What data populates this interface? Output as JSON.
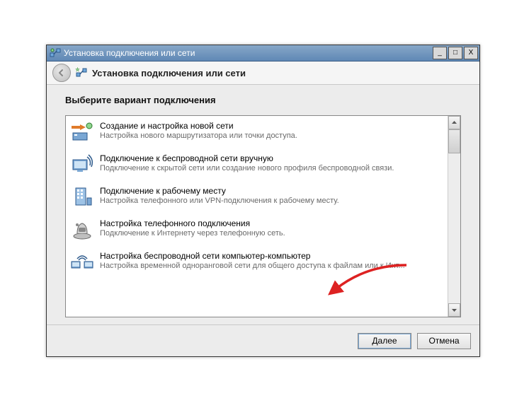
{
  "window": {
    "title": "Установка подключения или сети"
  },
  "header": {
    "title": "Установка подключения или сети"
  },
  "page": {
    "heading": "Выберите вариант подключения"
  },
  "options": [
    {
      "title": "Создание и настройка новой сети",
      "desc": "Настройка нового маршрутизатора или точки доступа.",
      "icon": "router-new-icon"
    },
    {
      "title": "Подключение к беспроводной сети вручную",
      "desc": "Подключение к скрытой сети или создание нового профиля беспроводной связи.",
      "icon": "wireless-manual-icon"
    },
    {
      "title": "Подключение к рабочему месту",
      "desc": "Настройка телефонного или VPN-подключения к рабочему месту.",
      "icon": "workplace-icon"
    },
    {
      "title": "Настройка телефонного подключения",
      "desc": "Подключение к Интернету через телефонную сеть.",
      "icon": "dialup-icon"
    },
    {
      "title": "Настройка беспроводной сети компьютер-компьютер",
      "desc": "Настройка временной одноранговой сети для общего доступа к файлам или к Инт...",
      "icon": "adhoc-icon"
    }
  ],
  "buttons": {
    "next": "Далее",
    "cancel": "Отмена"
  },
  "controls": {
    "minimize": "_",
    "maximize": "□",
    "close": "X"
  }
}
